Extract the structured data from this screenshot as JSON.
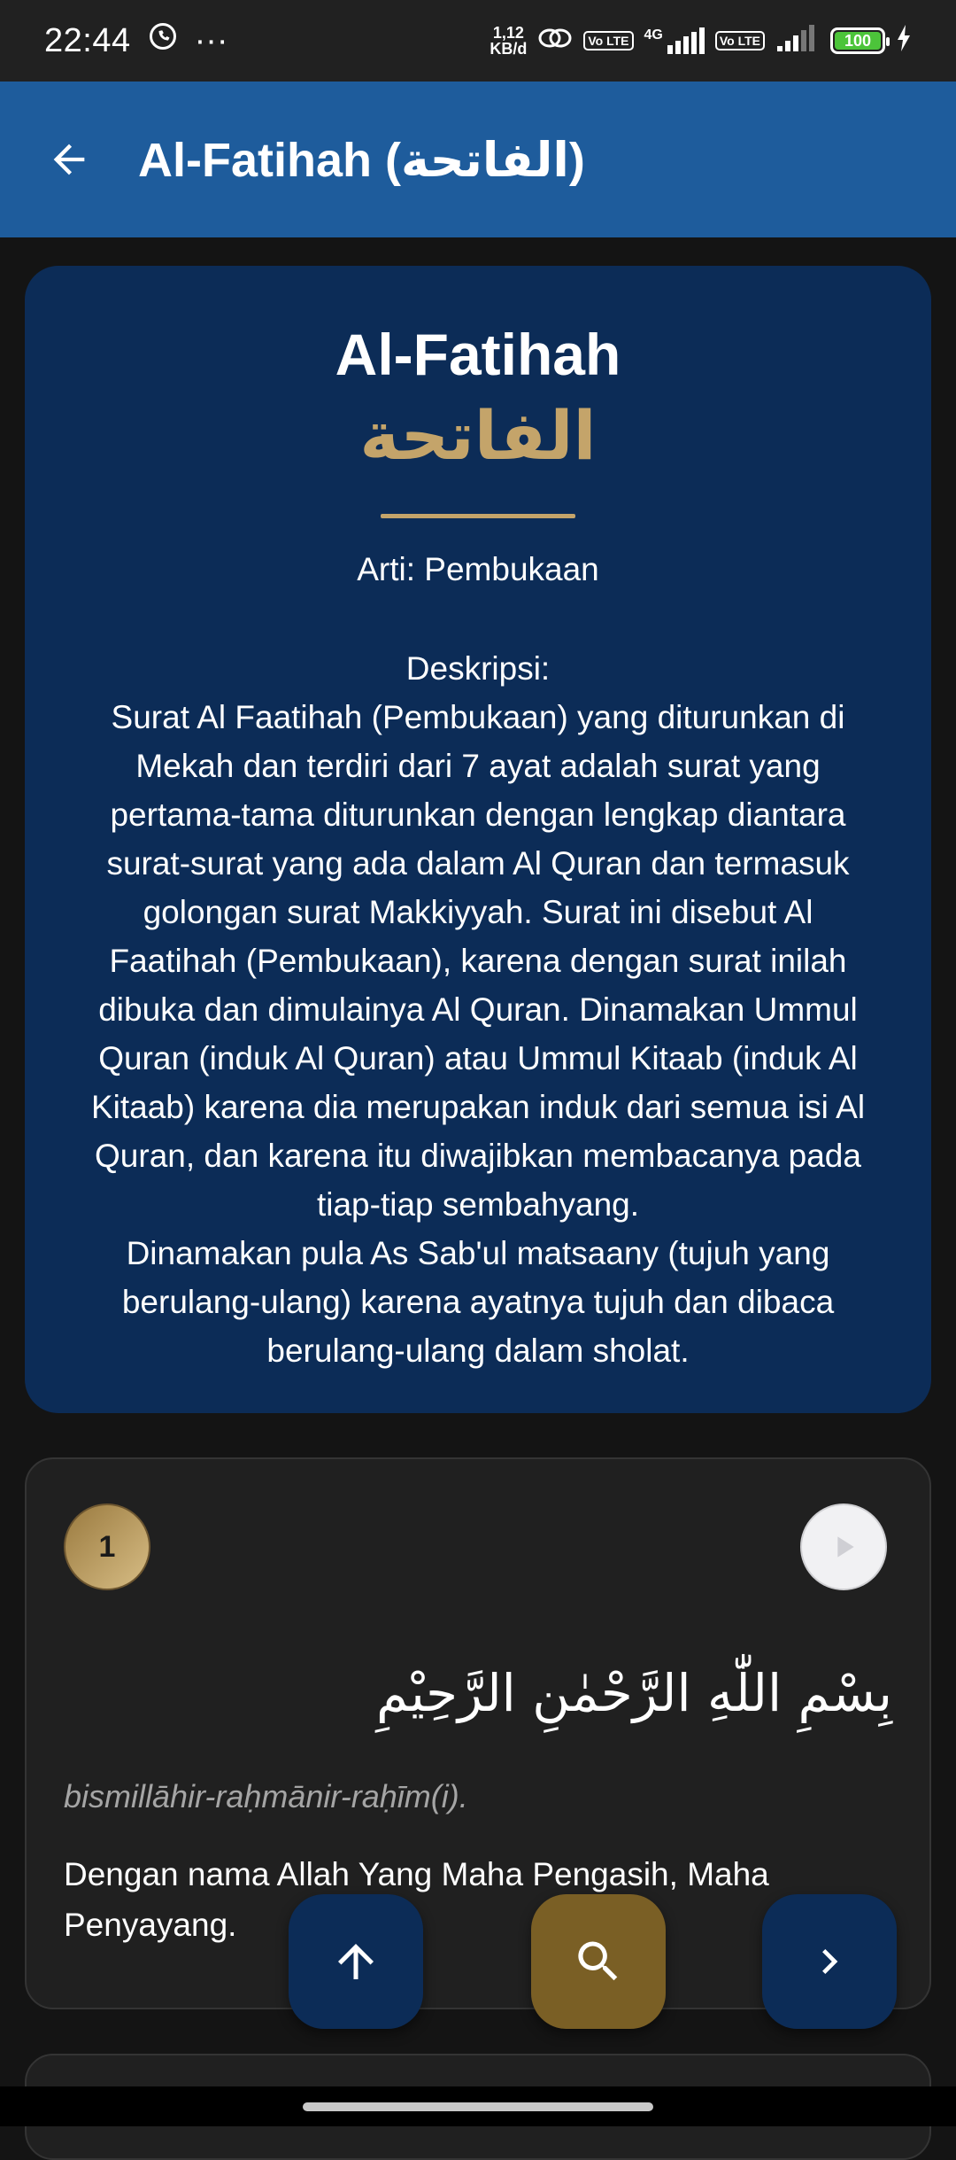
{
  "status_bar": {
    "time": "22:44",
    "more": "···",
    "net_speed_value": "1,12",
    "net_speed_unit": "KB/d",
    "lte1": "Vo LTE",
    "net_type": "4G",
    "lte2": "Vo LTE",
    "battery": "100"
  },
  "app_bar": {
    "title": "Al-Fatihah (الفاتحة)"
  },
  "surah": {
    "name_latin": "Al-Fatihah",
    "name_arabic": "الفاتحة",
    "meaning": "Arti: Pembukaan",
    "description_label": "Deskripsi:",
    "description": "Surat Al Faatihah (Pembukaan) yang diturunkan di Mekah dan terdiri dari 7 ayat adalah surat yang pertama-tama diturunkan dengan lengkap diantara surat-surat yang ada dalam Al Quran dan termasuk golongan surat Makkiyyah. Surat ini disebut Al Faatihah (Pembukaan), karena dengan surat inilah dibuka dan dimulainya Al Quran. Dinamakan Ummul Quran (induk Al Quran) atau Ummul Kitaab (induk Al Kitaab) karena dia merupakan induk dari semua isi Al Quran, dan karena itu diwajibkan membacanya pada tiap-tiap sembahyang.",
    "description_2": "Dinamakan pula As Sab'ul matsaany (tujuh yang berulang-ulang) karena ayatnya tujuh dan dibaca berulang-ulang dalam sholat."
  },
  "ayah": {
    "number": "1",
    "arabic": "بِسْمِ اللّٰهِ الرَّحْمٰنِ الرَّحِيْمِ",
    "latin": "bismillāhir-raḥmānir-raḥīm(i).",
    "translation": "Dengan nama Allah Yang Maha Pengasih, Maha Penyayang."
  },
  "icons": {
    "back": "arrow-left-icon",
    "play": "play-icon",
    "scroll_up": "arrow-up-icon",
    "search": "search-icon",
    "next": "chevron-right-icon"
  },
  "colors": {
    "app_bar": "#1e5c9c",
    "card": "#0c2c57",
    "gold": "#c4a46a",
    "background": "#141414"
  }
}
